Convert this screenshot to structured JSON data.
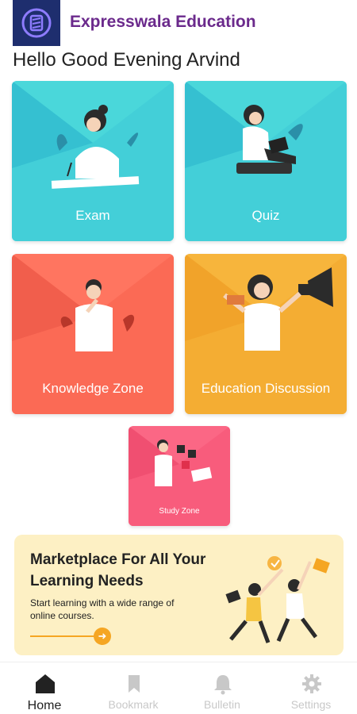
{
  "header": {
    "app_title": "Expresswala Education"
  },
  "greeting": "Hello Good Evening Arvind",
  "cards": [
    {
      "label": "Exam",
      "color_top": "#4ad7da",
      "color_fold": "#2fb9cf"
    },
    {
      "label": "Quiz",
      "color_top": "#4ad7da",
      "color_fold": "#2fb9cf"
    },
    {
      "label": "Knowledge Zone",
      "color_top": "#ff7560",
      "color_fold": "#ec5a48"
    },
    {
      "label": "Education Discussion",
      "color_top": "#f7b53c",
      "color_fold": "#ef9e27"
    },
    {
      "label": "Study Zone",
      "color_top": "#fb6785",
      "color_fold": "#ec4a6c"
    }
  ],
  "banner": {
    "title": "Marketplace For All Your Learning Needs",
    "subtitle": "Start learning with a wide range of online courses."
  },
  "bottom_nav": [
    {
      "label": "Home",
      "icon": "home-icon",
      "active": true
    },
    {
      "label": "Bookmark",
      "icon": "bookmark-icon",
      "active": false
    },
    {
      "label": "Bulletin",
      "icon": "bell-icon",
      "active": false
    },
    {
      "label": "Settings",
      "icon": "gear-icon",
      "active": false
    }
  ],
  "colors": {
    "brand_title": "#6b2a8c",
    "logo_bg": "#1e2e6e",
    "banner_bg": "#fdf0c4",
    "accent": "#f5a623"
  }
}
